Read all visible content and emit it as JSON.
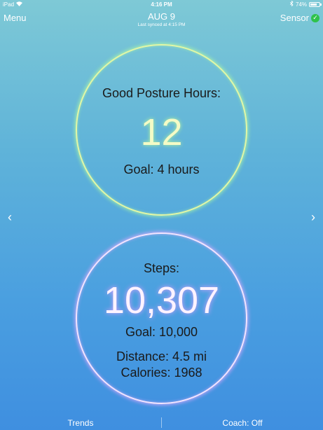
{
  "status_bar": {
    "device": "iPad",
    "time": "4:16 PM",
    "battery": "74%",
    "battery_level": 0.74
  },
  "nav": {
    "menu_label": "Menu",
    "title": "AUG 9",
    "subtitle": "Last synced at 4:15 PM",
    "sensor_label": "Sensor",
    "sensor_status_icon": "check-icon",
    "check_glyph": "✓"
  },
  "arrows": {
    "prev_glyph": "‹",
    "next_glyph": "›"
  },
  "posture": {
    "label": "Good Posture Hours:",
    "value": "12",
    "goal": "Goal: 4 hours"
  },
  "steps": {
    "label": "Steps:",
    "value": "10,307",
    "goal": "Goal: 10,000",
    "distance": "Distance: 4.5 mi",
    "calories": "Calories: 1968"
  },
  "tabs": [
    {
      "label": "Trends"
    },
    {
      "label": "Coach: Off"
    }
  ],
  "colors": {
    "posture_ring": "#e2f7a6",
    "steps_ring": "#f2e4ff",
    "sensor_ok": "#2fc24b"
  }
}
